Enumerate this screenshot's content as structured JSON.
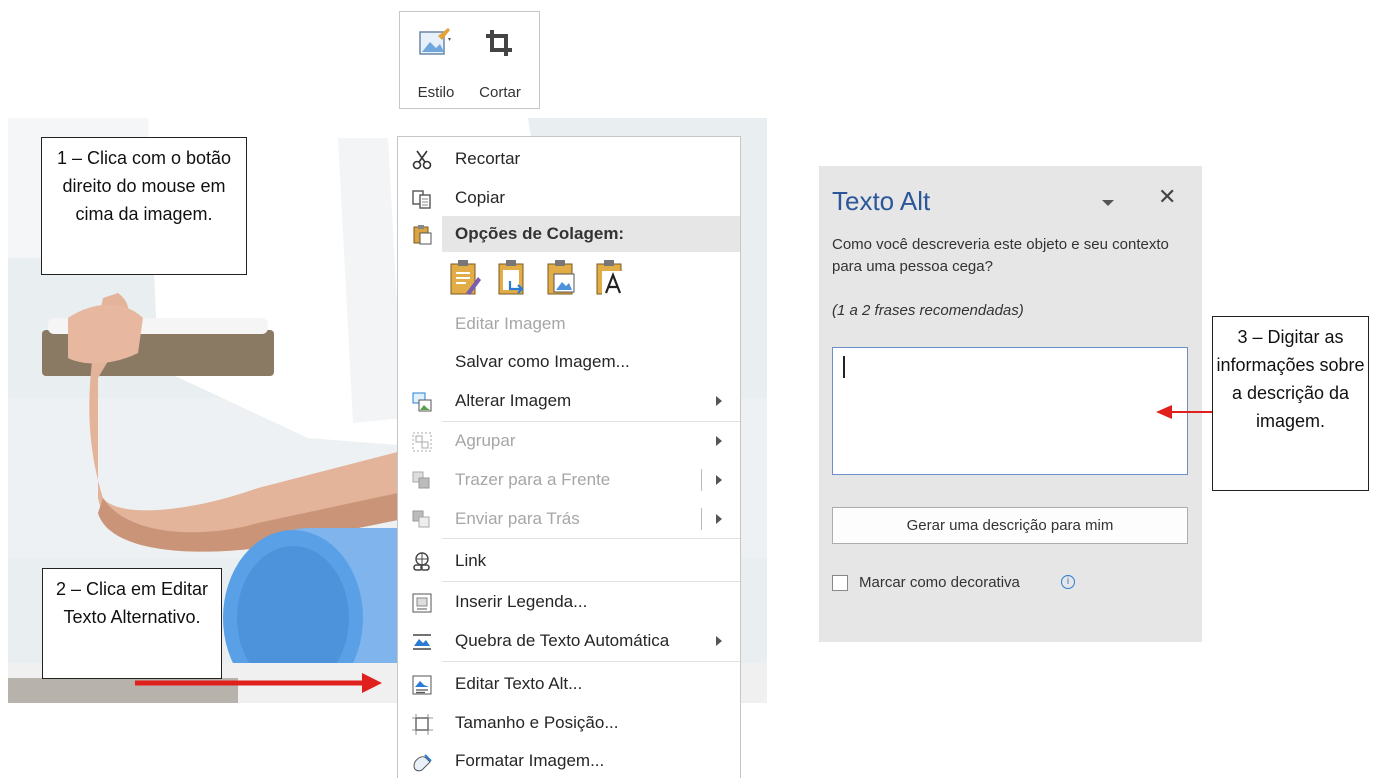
{
  "mini_toolbar": {
    "style_label": "Estilo",
    "crop_label": "Cortar"
  },
  "context_menu": {
    "items": [
      {
        "label": "Recortar",
        "icon": "scissors-icon",
        "enabled": true
      },
      {
        "label": "Copiar",
        "icon": "copy-icon",
        "enabled": true
      },
      {
        "label": "Opções de Colagem:",
        "icon": "paste-icon",
        "enabled": true
      },
      {
        "label": "Editar Imagem",
        "enabled": false
      },
      {
        "label": "Salvar como Imagem...",
        "enabled": true
      },
      {
        "label": "Alterar Imagem",
        "icon": "change-picture-icon",
        "enabled": true
      },
      {
        "label": "Agrupar",
        "icon": "group-icon",
        "enabled": false
      },
      {
        "label": "Trazer para a Frente",
        "icon": "bring-forward-icon",
        "enabled": false
      },
      {
        "label": "Enviar para Trás",
        "icon": "send-backward-icon",
        "enabled": false
      },
      {
        "label": "Link",
        "icon": "link-icon",
        "enabled": true
      },
      {
        "label": "Inserir Legenda...",
        "icon": "caption-icon",
        "enabled": true
      },
      {
        "label": "Quebra de Texto Automática",
        "icon": "wrap-text-icon",
        "enabled": true
      },
      {
        "label": "Editar Texto Alt...",
        "icon": "alt-text-icon",
        "enabled": true
      },
      {
        "label": "Tamanho e Posição...",
        "icon": "size-position-icon",
        "enabled": true
      },
      {
        "label": "Formatar Imagem...",
        "icon": "format-picture-icon",
        "enabled": true
      }
    ],
    "paste_options": [
      "paste-keep-formatting-icon",
      "paste-merge-icon",
      "paste-picture-icon",
      "paste-text-only-icon"
    ]
  },
  "alt_text_pane": {
    "title": "Texto Alt",
    "question": "Como você descreveria este objeto e seu contexto para uma pessoa cega?",
    "hint": "(1 a 2 frases recomendadas)",
    "input_value": "",
    "generate_label": "Gerar uma descrição para mim",
    "decorative_label": "Marcar como decorativa",
    "decorative_checked": false,
    "info_glyph": "i"
  },
  "callouts": {
    "step1": "1 – Clica com o botão direito do mouse em cima da imagem.",
    "step2": "2 – Clica em Editar Texto Alternativo.",
    "step3": "3 – Digitar as informações sobre a descrição da imagem."
  },
  "colors": {
    "accent_blue": "#2b579a",
    "arrow_red": "#e0201c",
    "pane_bg": "#e6e6e6",
    "foam_roller_blue": "#5aa0e6"
  }
}
